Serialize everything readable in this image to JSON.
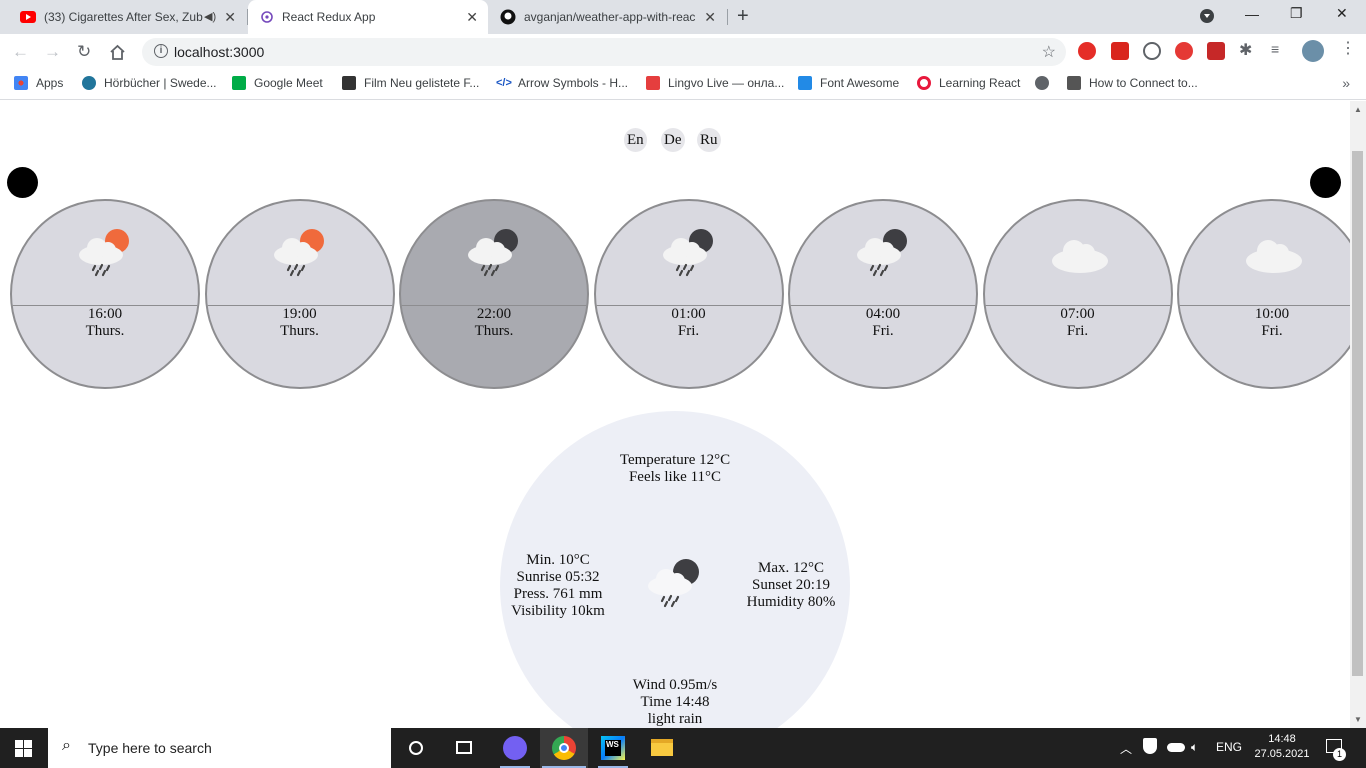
{
  "browser": {
    "tabs": [
      {
        "title": "(33) Cigarettes After Sex, Zub",
        "icon": "youtube-icon"
      },
      {
        "title": "React Redux App",
        "icon": "redux-icon"
      },
      {
        "title": "avganjan/weather-app-with-reac",
        "icon": "github-icon"
      }
    ],
    "url": "localhost:3000",
    "bookmarks": [
      {
        "label": "Apps"
      },
      {
        "label": "Hörbücher | Swede..."
      },
      {
        "label": "Google Meet"
      },
      {
        "label": "Film Neu gelistete F..."
      },
      {
        "label": "Arrow Symbols - H..."
      },
      {
        "label": "Lingvo Live — онла..."
      },
      {
        "label": "Font Awesome"
      },
      {
        "label": "Learning React"
      },
      {
        "label": ""
      },
      {
        "label": "How to Connect to..."
      }
    ]
  },
  "languages": [
    "En",
    "De",
    "Ru"
  ],
  "forecast": [
    {
      "time": "16:00",
      "day": "Thurs.",
      "icon": "rain-sun-icon"
    },
    {
      "time": "19:00",
      "day": "Thurs.",
      "icon": "rain-sun-icon"
    },
    {
      "time": "22:00",
      "day": "Thurs.",
      "icon": "rain-moon-icon"
    },
    {
      "time": "01:00",
      "day": "Fri.",
      "icon": "rain-moon-icon"
    },
    {
      "time": "04:00",
      "day": "Fri.",
      "icon": "rain-moon-icon"
    },
    {
      "time": "07:00",
      "day": "Fri.",
      "icon": "cloud-icon"
    },
    {
      "time": "10:00",
      "day": "Fri.",
      "icon": "cloud-icon"
    }
  ],
  "selected_index": 2,
  "details": {
    "temperature": "Temperature 12°C",
    "feels_like": "Feels like 11°C",
    "min": "Min. 10°C",
    "sunrise": "Sunrise 05:32",
    "pressure": "Press. 761 mm",
    "visibility": "Visibility 10km",
    "max": "Max. 12°C",
    "sunset": "Sunset 20:19",
    "humidity": "Humidity 80%",
    "wind": "Wind 0.95m/s",
    "time": "Time 14:48",
    "description": "light rain"
  },
  "taskbar": {
    "search_placeholder": "Type here to search",
    "language": "ENG",
    "time": "14:48",
    "date": "27.05.2021",
    "notifications": "1"
  },
  "colors": {
    "sun": "#f06a3c",
    "moon": "#3e3e42",
    "cloud": "#f3f3f3",
    "selected_card": "#a9aab0",
    "card": "#d9d9e0"
  }
}
